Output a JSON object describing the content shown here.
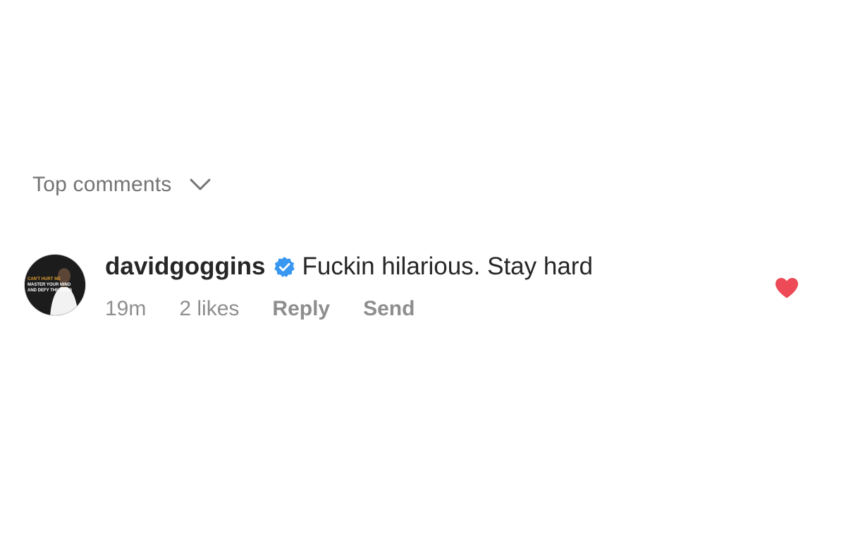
{
  "sort": {
    "label": "Top comments",
    "icon": "chevron-down-icon"
  },
  "comment": {
    "username": "davidgoggins",
    "verified_icon": "verified-badge-icon",
    "text": "Fuckin hilarious. Stay hard",
    "time": "19m",
    "likes": "2 likes",
    "reply_label": "Reply",
    "send_label": "Send",
    "liked": true,
    "like_icon": "heart-icon",
    "avatar_text": [
      "CAN'T HURT ME",
      "MASTER YOUR MIND",
      "AND DEFY THE ODDS"
    ]
  },
  "colors": {
    "verified_blue": "#3897f0",
    "heart_red": "#ed4956",
    "muted_text": "#8e8e8e"
  }
}
